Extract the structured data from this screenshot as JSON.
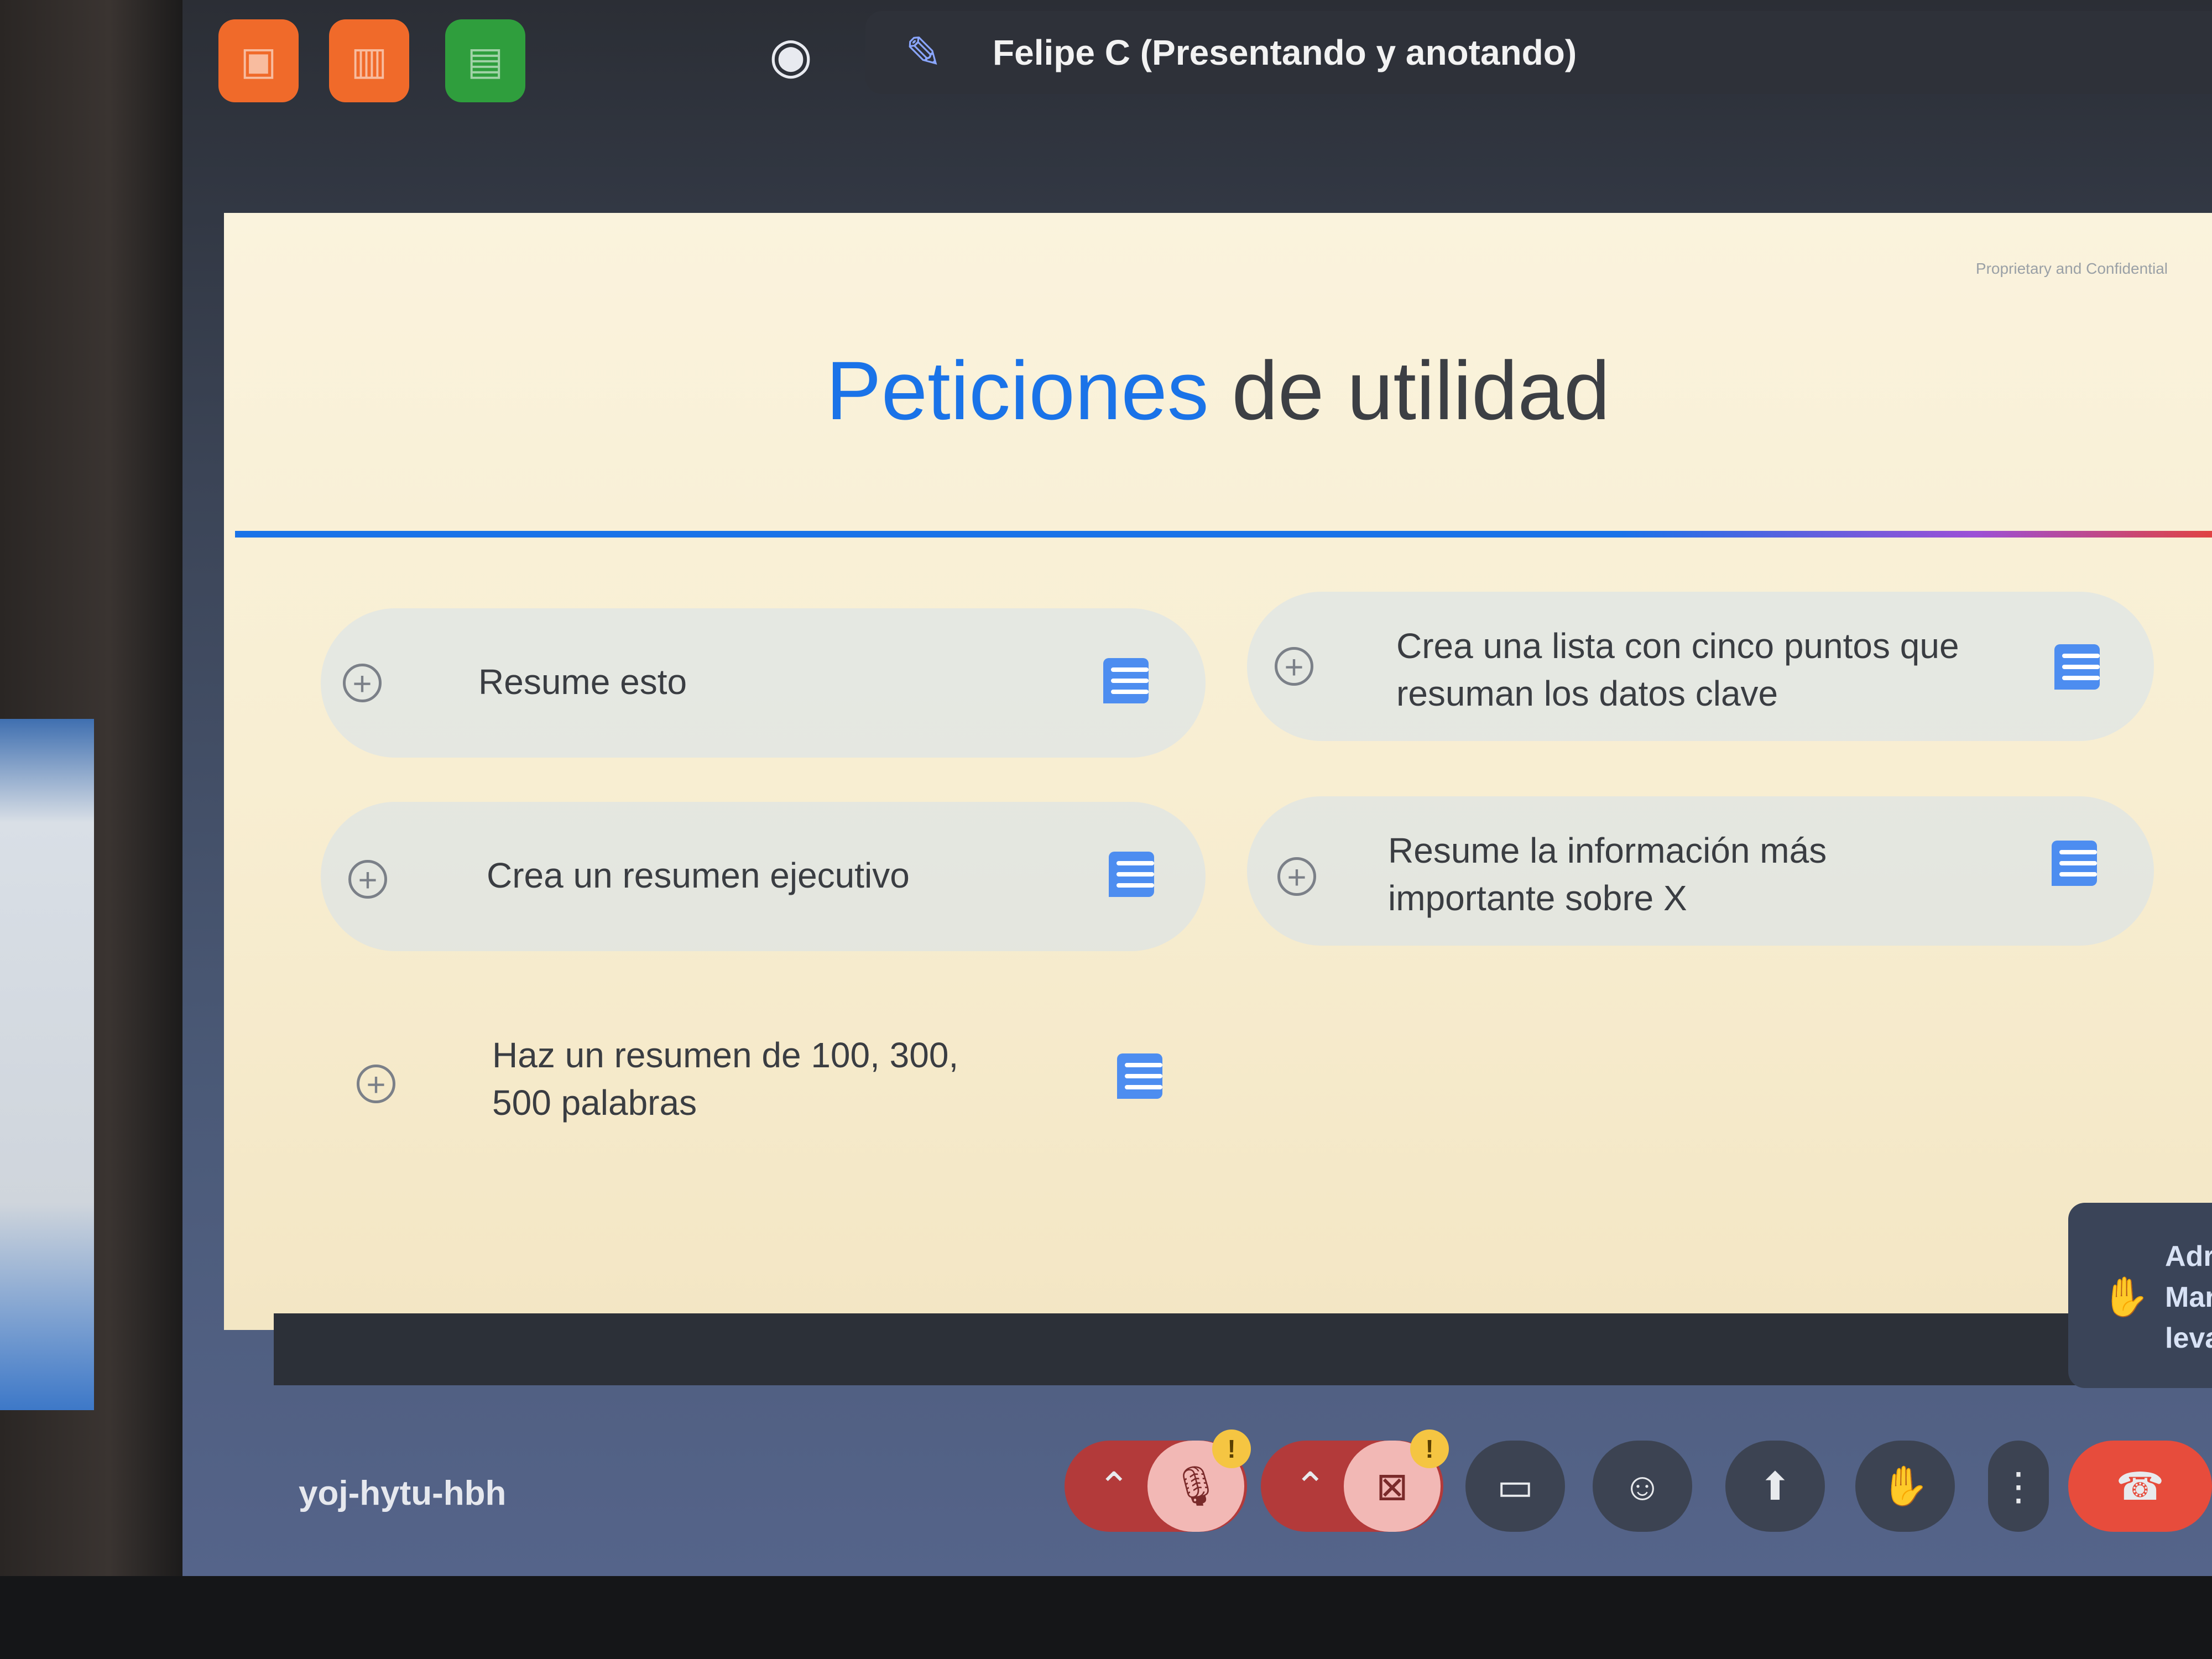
{
  "topbar": {
    "presenter_name": "Felipe C (Presentando y anotando)"
  },
  "slide": {
    "confidential": "Proprietary and Confidential",
    "title_part1": "Peticiones",
    "title_part2": "de utilidad",
    "cards": [
      {
        "text": "Resume esto"
      },
      {
        "text": "Crea una lista con cinco puntos que resuman los datos clave"
      },
      {
        "text": "Crea un resumen ejecutivo"
      },
      {
        "text": "Resume la información más importante sobre X"
      },
      {
        "text": "Haz un resumen de 100, 300, 500 palabras"
      }
    ]
  },
  "hand_panel": {
    "line1": "Adr",
    "line2": "Mar",
    "line3": "leva"
  },
  "meeting": {
    "code": "yoj-hytu-hbh"
  }
}
